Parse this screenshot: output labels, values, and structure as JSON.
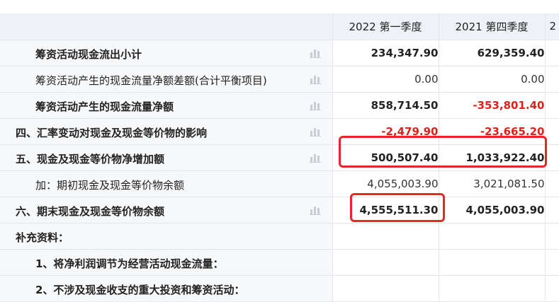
{
  "table": {
    "columns": [
      "2022 第一季度",
      "2021 第四季度",
      "2"
    ],
    "rows": [
      {
        "label": "筹资活动现金流出小计",
        "values": [
          "234,347.90",
          "629,359.40"
        ]
      },
      {
        "label": "筹资活动产生的现金流量净额差额(合计平衡项目)",
        "values": [
          "0.00",
          "0.00"
        ]
      },
      {
        "label": "筹资活动产生的现金流量净额",
        "values": [
          "858,714.50",
          "-353,801.40"
        ]
      },
      {
        "label": "四、汇率变动对现金及现金等价物的影响",
        "values": [
          "-2,479.90",
          "-23,665.20"
        ]
      },
      {
        "label": "五、现金及现金等价物净增加额",
        "values": [
          "500,507.40",
          "1,033,922.40"
        ]
      },
      {
        "label": "加：期初现金及现金等价物余额",
        "values": [
          "4,055,003.90",
          "3,021,081.50"
        ]
      },
      {
        "label": "六、期末现金及现金等价物余额",
        "values": [
          "4,555,511.30",
          "4,055,003.90"
        ]
      },
      {
        "label": "补充资料：",
        "values": [
          "",
          ""
        ]
      },
      {
        "label": "1、将净利润调节为经营活动现金流量：",
        "values": [
          "",
          ""
        ]
      },
      {
        "label": "2、不涉及现金收支的重大投资和筹资活动：",
        "values": [
          "",
          ""
        ]
      }
    ]
  },
  "colors": {
    "negative": "#e0201c",
    "annotation": "#e8262a",
    "header_bg": "#eef1f6",
    "label_bg": "#f7f8fa",
    "chart_icon": "#c9ced6"
  },
  "icons": {
    "row_chart": "bar-chart-icon"
  }
}
